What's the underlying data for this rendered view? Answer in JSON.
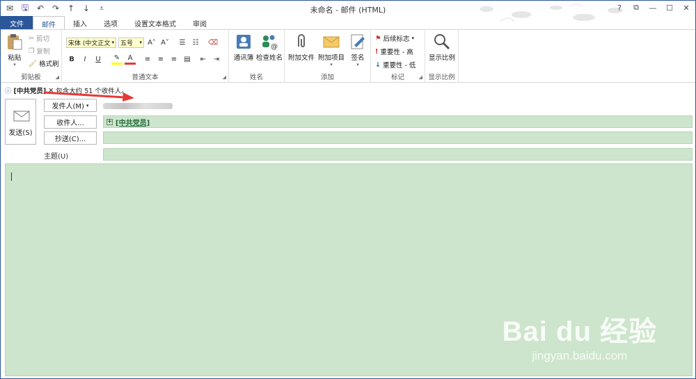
{
  "window": {
    "title": "未命名 - 邮件 (HTML)",
    "controls": [
      "?",
      "⧉",
      "—",
      "☐",
      "✕"
    ]
  },
  "qat": {
    "icons": [
      "outlook-icon",
      "save-icon",
      "undo-icon",
      "redo-icon",
      "up-icon",
      "down-icon",
      "customize-icon"
    ]
  },
  "tabs": {
    "file": "文件",
    "items": [
      "邮件",
      "插入",
      "选项",
      "设置文本格式",
      "审阅"
    ],
    "active": "邮件"
  },
  "ribbon": {
    "clipboard": {
      "label": "剪贴板",
      "paste": "粘贴",
      "cut": "剪切",
      "copy": "复制",
      "format_painter": "格式刷"
    },
    "basic_text": {
      "label": "普通文本",
      "font": "宋体 (中文正文",
      "size": "五号",
      "bold": "B",
      "italic": "I",
      "underline": "U",
      "font_color": "A"
    },
    "names": {
      "label": "姓名",
      "address_book": "通讯簿",
      "check_names": "检查姓名"
    },
    "include": {
      "label": "添加",
      "attach_file": "附加文件",
      "attach_item": "附加项目",
      "signature": "签名"
    },
    "tags": {
      "label": "标记",
      "follow_up": "后续标志",
      "high_importance": "重要性 - 高",
      "low_importance": "重要性 - 低"
    },
    "zoom": {
      "label": "显示比例",
      "zoom": "显示比例"
    }
  },
  "info": {
    "group_name": "[中共党员]",
    "text": "包含大约 51 个收件人。"
  },
  "compose": {
    "send": "发送(S)",
    "from": "发件人(M)",
    "to": "收件人...",
    "cc": "抄送(C)...",
    "subject_label": "主题(U)",
    "to_value": "[中共党员]",
    "cc_value": "",
    "subject_value": ""
  },
  "watermark": {
    "main": "Bai du 经验",
    "url": "jingyan.baidu.com"
  },
  "colors": {
    "accent": "#2b579a",
    "field_bg": "#cce5cc",
    "arrow": "#e53935"
  }
}
